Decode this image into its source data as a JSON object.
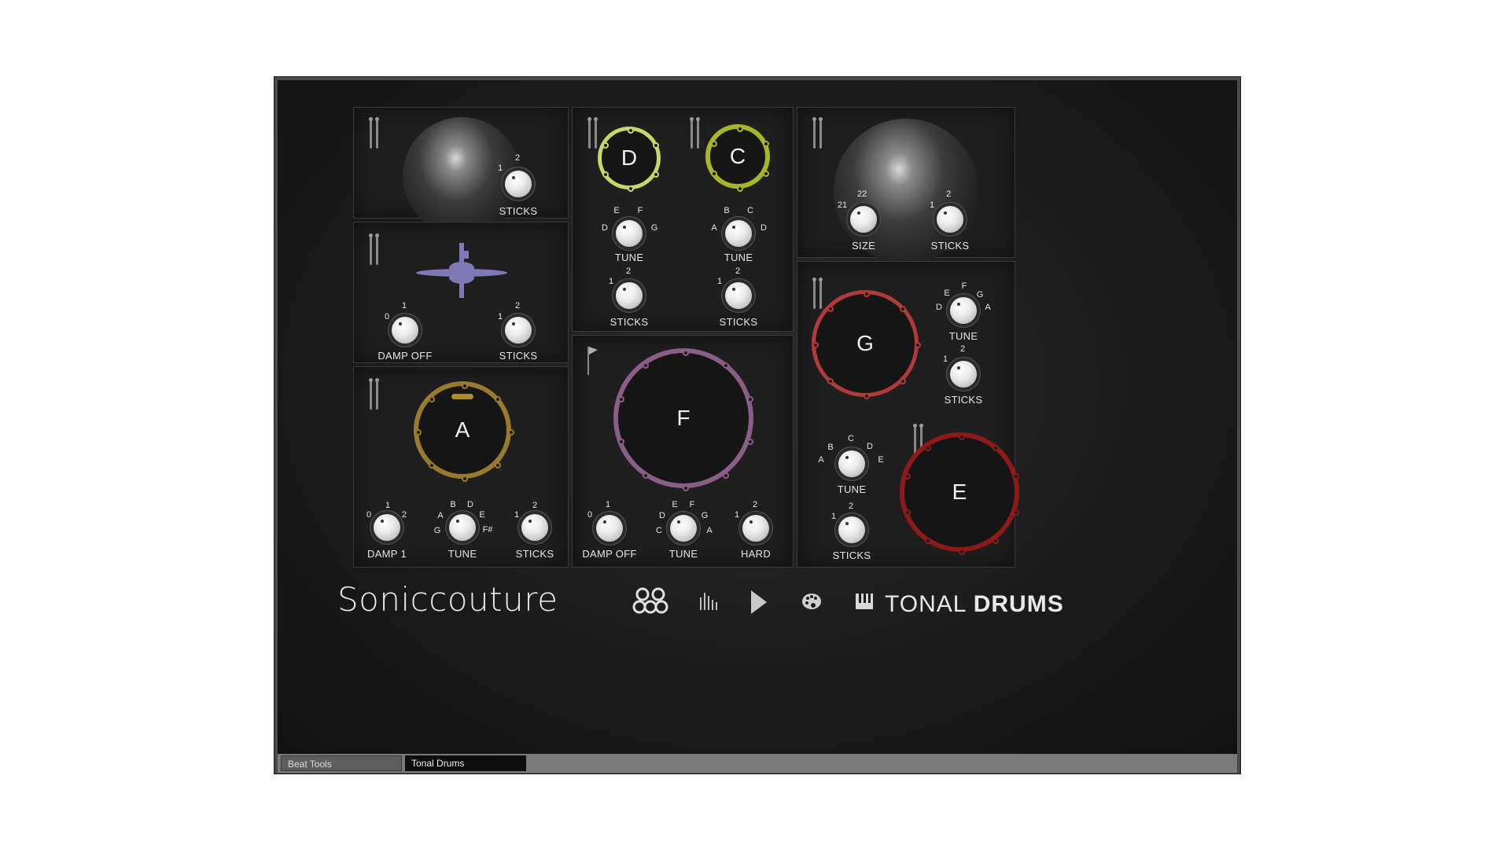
{
  "brand": "Soniccouture",
  "product": {
    "light": "TONAL",
    "bold": "DRUMS"
  },
  "tabs": [
    {
      "label": "Beat Tools",
      "active": false
    },
    {
      "label": "Tonal Drums",
      "active": true
    }
  ],
  "nav_icons": [
    "kit-icon",
    "mixer-icon",
    "play-icon",
    "palette-icon",
    "keyboard-icon"
  ],
  "cymbal1": {
    "knob_label": "STICKS",
    "nums": [
      "1",
      "2"
    ]
  },
  "hihat": {
    "damp": {
      "label": "DAMP OFF",
      "nums": [
        "0",
        "1"
      ]
    },
    "sticks": {
      "label": "STICKS",
      "nums": [
        "1",
        "2"
      ]
    }
  },
  "drum_a": {
    "letter": "A",
    "color": "#9a7a2c",
    "damp": {
      "label": "DAMP 1",
      "nums": [
        "0",
        "1",
        "2"
      ]
    },
    "tune": {
      "label": "TUNE",
      "nums": [
        "G",
        "A",
        "B",
        "D",
        "E",
        "F#"
      ]
    },
    "sticks": {
      "label": "STICKS",
      "nums": [
        "1",
        "2"
      ]
    }
  },
  "drum_d": {
    "letter": "D",
    "color": "#c5d86a",
    "tune": {
      "label": "TUNE",
      "nums": [
        "D",
        "E",
        "F",
        "G"
      ]
    },
    "sticks": {
      "label": "STICKS",
      "nums": [
        "1",
        "2"
      ]
    }
  },
  "drum_c": {
    "letter": "C",
    "color": "#a7b52a",
    "tune": {
      "label": "TUNE",
      "nums": [
        "A",
        "B",
        "C",
        "D"
      ]
    },
    "sticks": {
      "label": "STICKS",
      "nums": [
        "1",
        "2"
      ]
    }
  },
  "drum_f": {
    "letter": "F",
    "color": "#8a5e86",
    "damp": {
      "label": "DAMP OFF",
      "nums": [
        "0",
        "1"
      ]
    },
    "tune": {
      "label": "TUNE",
      "nums": [
        "C",
        "D",
        "E",
        "F",
        "G",
        "A"
      ]
    },
    "hard": {
      "label": "HARD",
      "nums": [
        "1",
        "2"
      ]
    }
  },
  "cymbal2": {
    "size": {
      "label": "SIZE",
      "nums": [
        "21",
        "22"
      ]
    },
    "sticks": {
      "label": "STICKS",
      "nums": [
        "1",
        "2"
      ]
    }
  },
  "drum_g": {
    "letter": "G",
    "color": "#b33a3a",
    "tune": {
      "label": "TUNE",
      "nums": [
        "D",
        "E",
        "F",
        "G",
        "A"
      ]
    },
    "sticks": {
      "label": "STICKS",
      "nums": [
        "1",
        "2"
      ]
    }
  },
  "drum_e": {
    "letter": "E",
    "color": "#8e1a1a",
    "tune": {
      "label": "TUNE",
      "nums": [
        "A",
        "B",
        "C",
        "D",
        "E"
      ]
    },
    "sticks": {
      "label": "STICKS",
      "nums": [
        "1",
        "2"
      ]
    }
  }
}
